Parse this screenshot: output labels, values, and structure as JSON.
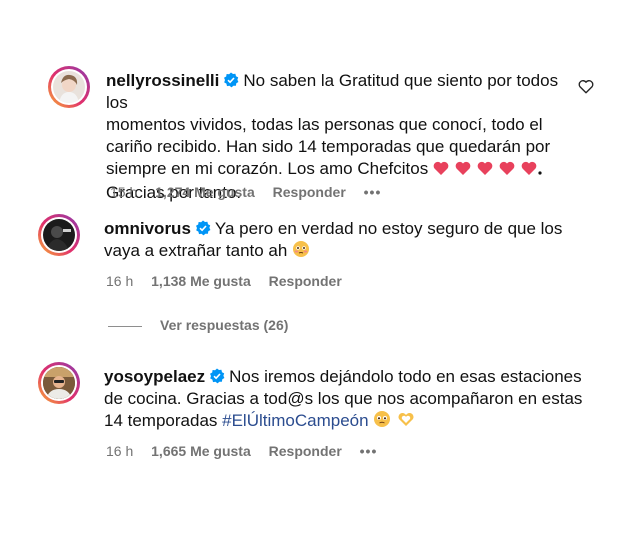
{
  "comments": [
    {
      "username": "nellyrossinelli",
      "verified": true,
      "lines": [
        "No saben la Gratitud que siento por todos los",
        "momentos vividos, todas las personas que conocí, todo el",
        "cariño recibido. Han sido 14 temporadas que quedarán por",
        "siempre en mi corazón. Los amo Chefcitos",
        "Gracias por tanto."
      ],
      "time": "15 h",
      "likes": "1,274 Me gusta",
      "reply": "Responder",
      "more": "•••"
    },
    {
      "username": "omnivorus",
      "verified": true,
      "lines": [
        "Ya pero en verdad no estoy seguro de que los",
        "vaya a extrañar tanto ah"
      ],
      "time": "16 h",
      "likes": "1,138 Me gusta",
      "reply": "Responder",
      "view_replies": "Ver respuestas (26)"
    },
    {
      "username": "yosoypelaez",
      "verified": true,
      "lines": [
        "Nos iremos dejándolo todo en esas estaciones",
        "de cocina. Gracias a tod@s los que nos acompañaron en estas",
        "14 temporadas"
      ],
      "hashtag": "#ElÚltimoCampeón",
      "time": "16 h",
      "likes": "1,665 Me gusta",
      "reply": "Responder",
      "more": "•••"
    }
  ],
  "colors": {
    "verified_blue": "#0095f6",
    "heart_pink": "#e8415c",
    "meta_gray": "#737373",
    "hashtag": "#2b4c8f"
  },
  "icons": {
    "like": "heart-outline-icon",
    "verified": "verified-badge-icon"
  }
}
